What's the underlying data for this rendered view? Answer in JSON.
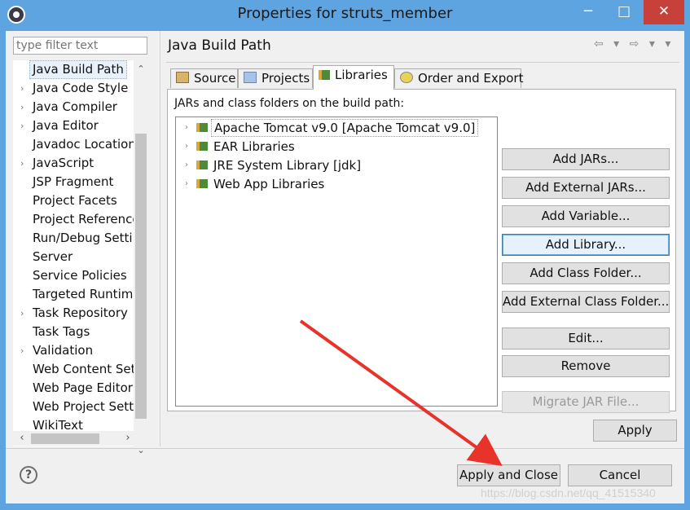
{
  "window": {
    "title": "Properties for struts_member",
    "minimize": "─",
    "maximize": "□",
    "close": "✕"
  },
  "filter": {
    "placeholder": "type filter text"
  },
  "tree": {
    "items": [
      {
        "label": "Java Build Path",
        "arrow": ""
      },
      {
        "label": "Java Code Style",
        "arrow": "›"
      },
      {
        "label": "Java Compiler",
        "arrow": "›"
      },
      {
        "label": "Java Editor",
        "arrow": "›"
      },
      {
        "label": "Javadoc Location",
        "arrow": ""
      },
      {
        "label": "JavaScript",
        "arrow": "›"
      },
      {
        "label": "JSP Fragment",
        "arrow": ""
      },
      {
        "label": "Project Facets",
        "arrow": ""
      },
      {
        "label": "Project References",
        "arrow": ""
      },
      {
        "label": "Run/Debug Settings",
        "arrow": ""
      },
      {
        "label": "Server",
        "arrow": ""
      },
      {
        "label": "Service Policies",
        "arrow": ""
      },
      {
        "label": "Targeted Runtimes",
        "arrow": ""
      },
      {
        "label": "Task Repository",
        "arrow": "›"
      },
      {
        "label": "Task Tags",
        "arrow": ""
      },
      {
        "label": "Validation",
        "arrow": "›"
      },
      {
        "label": "Web Content Settings",
        "arrow": ""
      },
      {
        "label": "Web Page Editor",
        "arrow": ""
      },
      {
        "label": "Web Project Settings",
        "arrow": ""
      },
      {
        "label": "WikiText",
        "arrow": ""
      }
    ],
    "scroll_up": "⌃",
    "scroll_down": "⌄",
    "scroll_left": "‹",
    "scroll_right": "›"
  },
  "page": {
    "title": "Java Build Path",
    "nav": "⇦ ▾ ⇨ ▾ ▾"
  },
  "tabs": [
    {
      "label": "Source",
      "icon": "source-folder-icon"
    },
    {
      "label": "Projects",
      "icon": "projects-icon"
    },
    {
      "label": "Libraries",
      "icon": "library-icon"
    },
    {
      "label": "Order and Export",
      "icon": "order-export-icon"
    }
  ],
  "libraries": {
    "caption": "JARs and class folders on the build path:",
    "items": [
      {
        "label": "Apache Tomcat v9.0 [Apache Tomcat v9.0]"
      },
      {
        "label": "EAR Libraries"
      },
      {
        "label": "JRE System Library [jdk]"
      },
      {
        "label": "Web App Libraries"
      }
    ],
    "expand_arrow": "›"
  },
  "buttons": {
    "add_jars": "Add JARs...",
    "add_external_jars": "Add External JARs...",
    "add_variable": "Add Variable...",
    "add_library": "Add Library...",
    "add_class_folder": "Add Class Folder...",
    "add_external_class_folder": "Add External Class Folder...",
    "edit": "Edit...",
    "remove": "Remove",
    "migrate_jar": "Migrate JAR File..."
  },
  "footer": {
    "apply": "Apply",
    "apply_and_close": "Apply and Close",
    "cancel": "Cancel",
    "help": "?"
  },
  "watermark": "https://blog.csdn.net/qq_41515340",
  "colors": {
    "titlebar": "#5ea4e0",
    "close": "#c7403a",
    "annotation_arrow": "#e8332a"
  }
}
